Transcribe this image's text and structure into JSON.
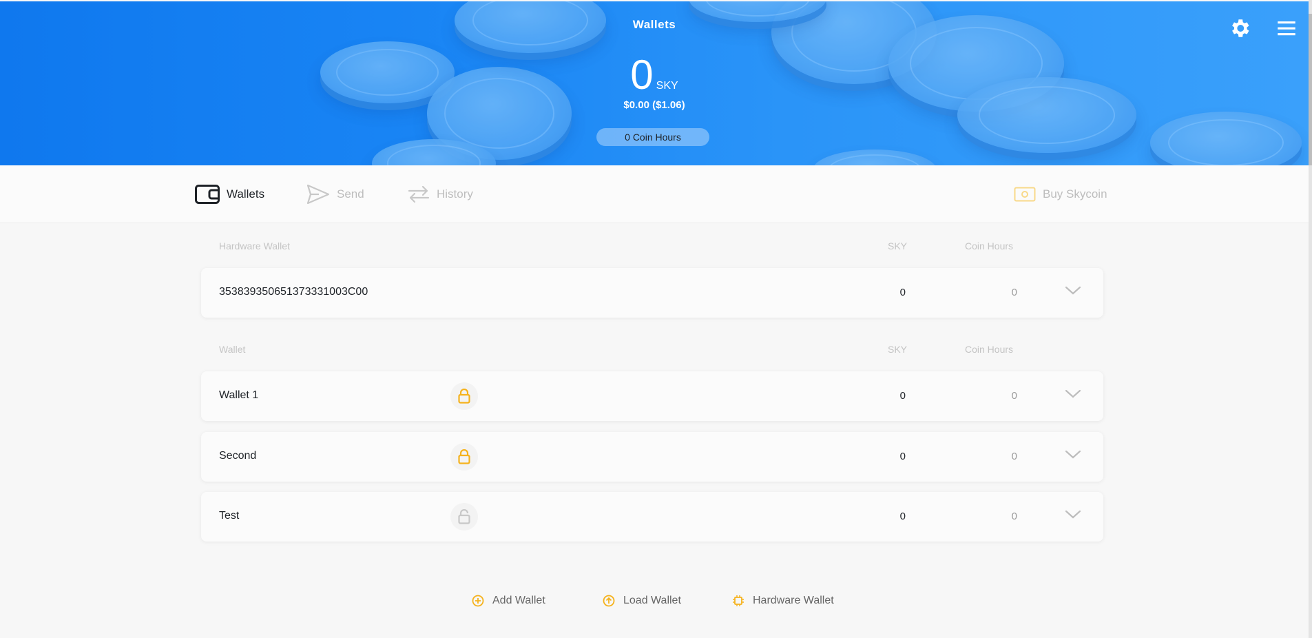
{
  "header": {
    "title": "Wallets",
    "balance_amount": "0",
    "balance_unit": "SKY",
    "fiat": "$0.00 ($1.06)",
    "coin_hours": "0 Coin Hours",
    "settings_icon": "gear-icon",
    "menu_icon": "hamburger-menu-icon"
  },
  "nav": {
    "tabs": [
      {
        "label": "Wallets",
        "icon": "wallet-icon",
        "active": true
      },
      {
        "label": "Send",
        "icon": "send-icon",
        "active": false
      },
      {
        "label": "History",
        "icon": "transfer-arrows-icon",
        "active": false
      }
    ],
    "buy": {
      "label": "Buy Skycoin",
      "icon": "cash-icon"
    }
  },
  "hardware_table": {
    "headers": {
      "name": "Hardware Wallet",
      "sky": "SKY",
      "hours": "Coin Hours"
    },
    "rows": [
      {
        "name": "3538393506513733310 03C00",
        "sky": "0",
        "hours": "0"
      }
    ]
  },
  "wallet_table": {
    "headers": {
      "name": "Wallet",
      "sky": "SKY",
      "hours": "Coin Hours"
    },
    "rows": [
      {
        "name": "Wallet 1",
        "locked": true,
        "sky": "0",
        "hours": "0"
      },
      {
        "name": "Second",
        "locked": true,
        "sky": "0",
        "hours": "0"
      },
      {
        "name": "Test",
        "locked": false,
        "sky": "0",
        "hours": "0"
      }
    ]
  },
  "actions": {
    "add": "Add Wallet",
    "load": "Load Wallet",
    "hardware": "Hardware Wallet"
  },
  "colors": {
    "accent": "#f5b21d",
    "header_blue": "#1a86f5",
    "text": "#1e2227",
    "muted": "#bdbdbd"
  }
}
